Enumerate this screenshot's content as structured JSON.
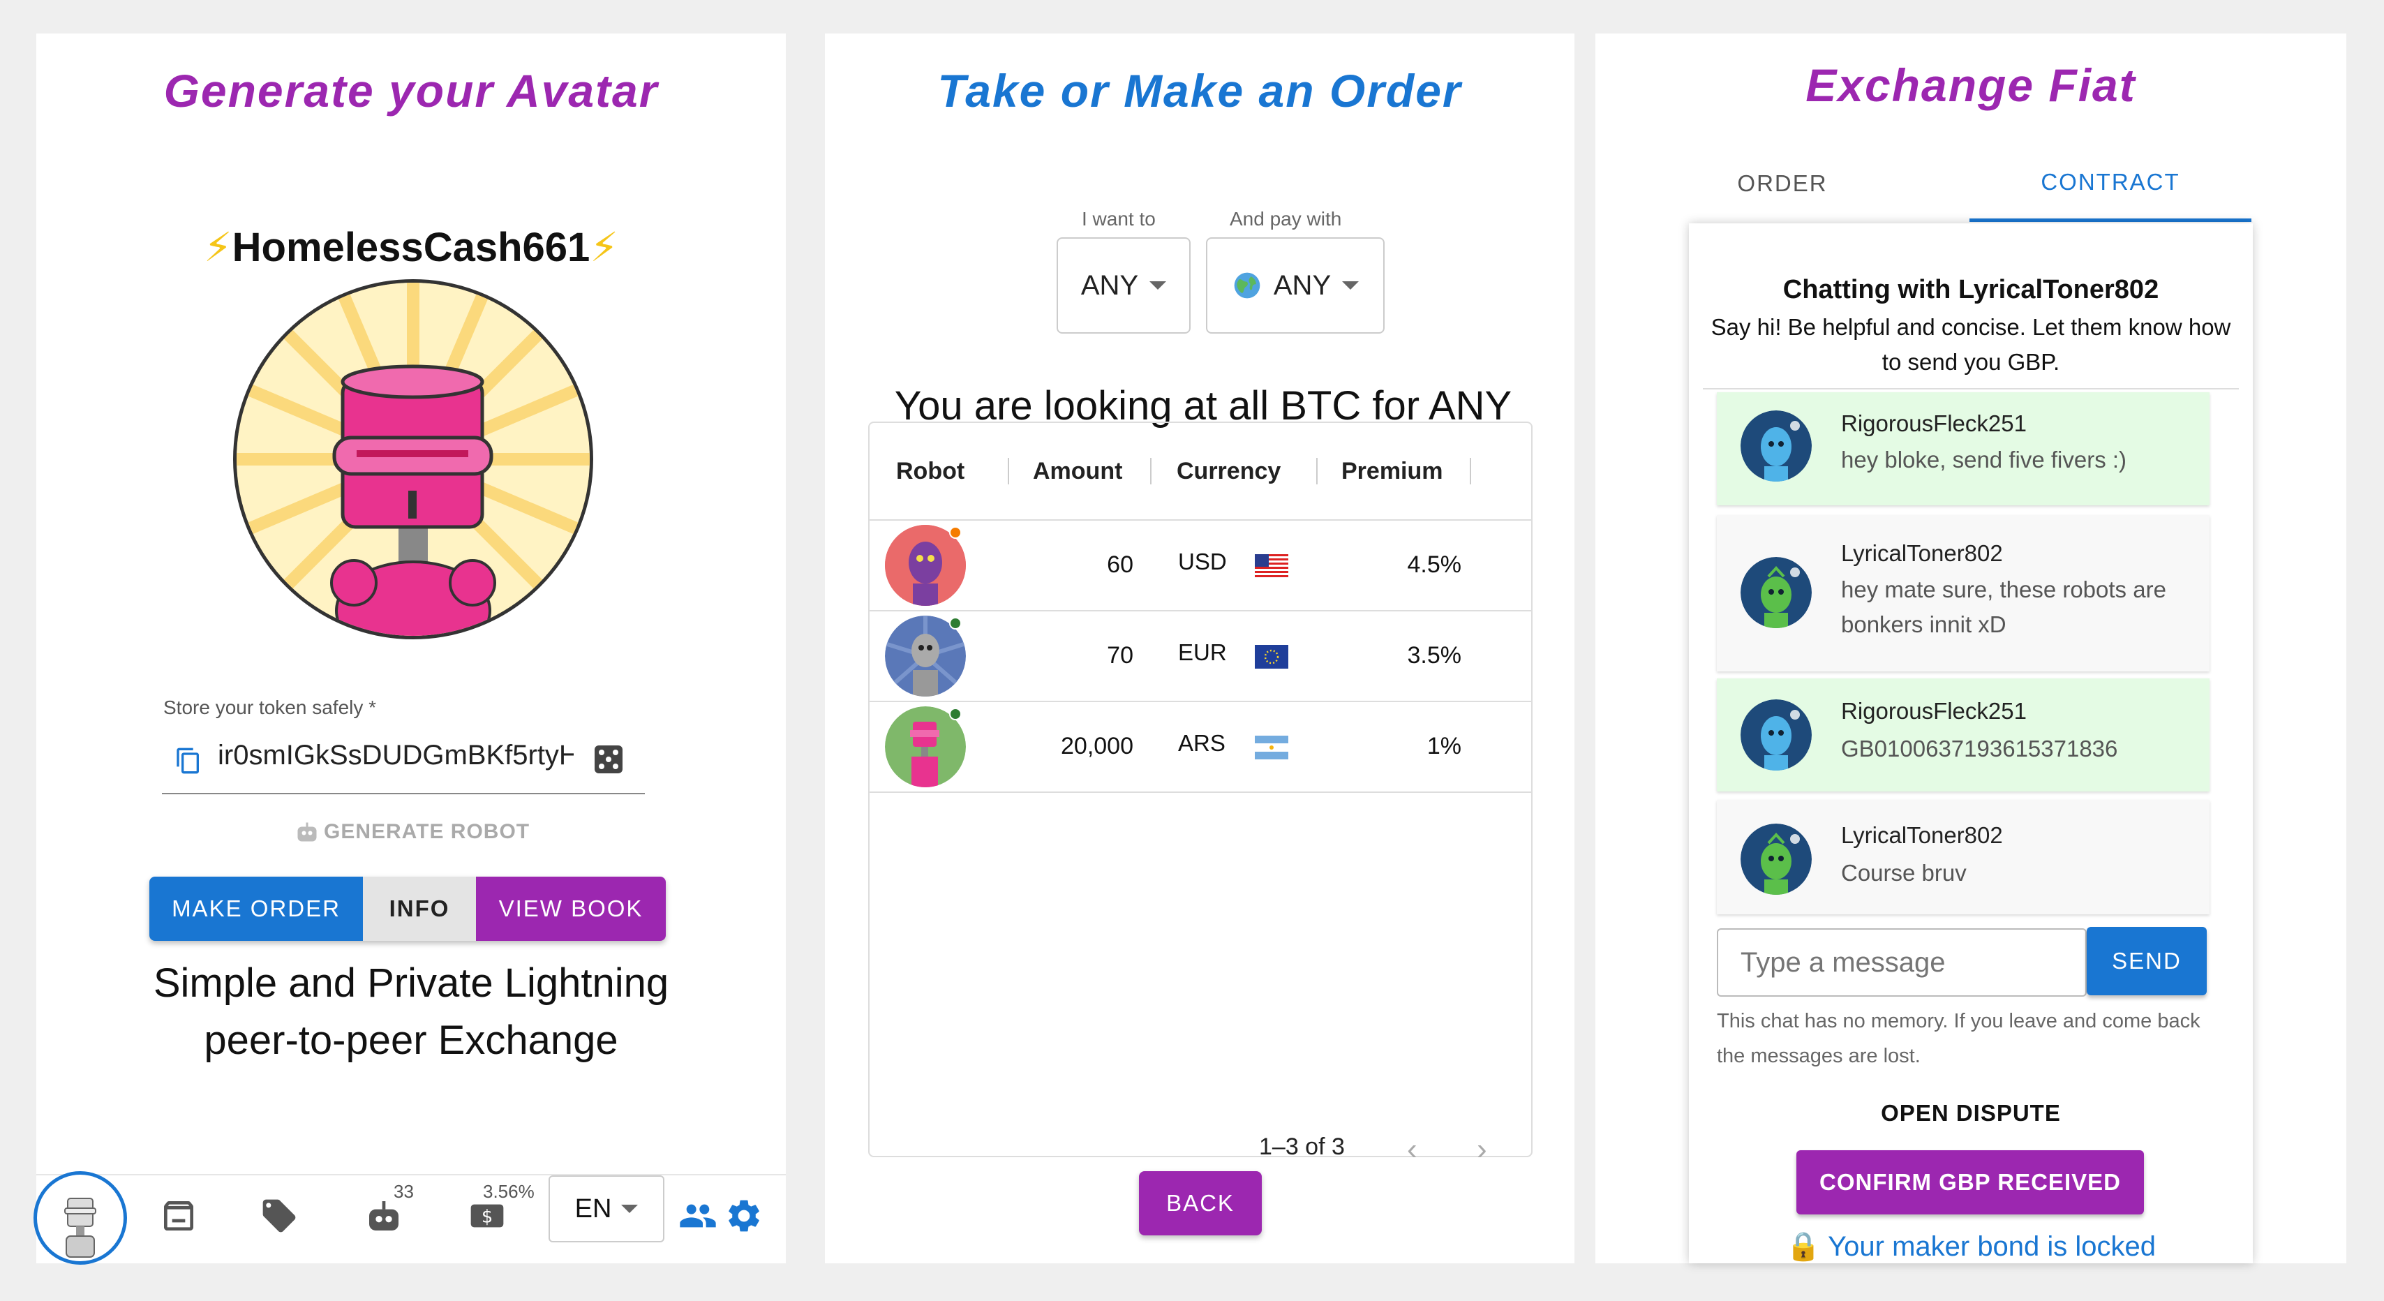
{
  "panel1": {
    "title": "Generate your Avatar",
    "nickname": "HomelessCash661",
    "bolt": "⚡",
    "token_label": "Store your token safely *",
    "token_value": "ir0smIGkSsDUDGmBKf5rtyH",
    "generate_label": "GENERATE ROBOT",
    "buttons": {
      "make_order": "MAKE ORDER",
      "info": "INFO",
      "view_book": "VIEW BOOK"
    },
    "tagline_1": "Simple and Private Lightning",
    "tagline_2": "peer-to-peer Exchange",
    "bottom_bar": {
      "robots_count": "33",
      "premium": "3.56%",
      "language": "EN"
    },
    "colors": {
      "purple": "#9c27b0",
      "blue": "#1976d2",
      "robot_pink": "#e8338f"
    }
  },
  "panel2": {
    "title": "Take or Make an Order",
    "want_label": "I want to",
    "want_value": "ANY",
    "pay_label": "And pay with",
    "pay_value": "ANY",
    "pay_icon": "globe-icon",
    "heading": "You are looking at all BTC for ANY",
    "columns": [
      "Robot",
      "Amount",
      "Currency",
      "Premium"
    ],
    "rows": [
      {
        "amount": "60",
        "currency": "USD",
        "flag": "us-flag",
        "premium": "4.5%",
        "status": "#f57c00"
      },
      {
        "amount": "70",
        "currency": "EUR",
        "flag": "eu-flag",
        "premium": "3.5%",
        "status": "#2e7d32"
      },
      {
        "amount": "20,000",
        "currency": "ARS",
        "flag": "ar-flag",
        "premium": "1%",
        "status": "#2e7d32"
      }
    ],
    "pagination": "1–3 of 3",
    "back": "BACK"
  },
  "panel3": {
    "title": "Exchange Fiat",
    "tabs": {
      "order": "ORDER",
      "contract": "CONTRACT"
    },
    "chat_title": "Chatting with LyricalToner802",
    "chat_sub": "Say hi! Be helpful and concise. Let them know how to send you GBP.",
    "messages": [
      {
        "name": "RigorousFleck251",
        "text": "hey bloke, send five fivers :)"
      },
      {
        "name": "LyricalToner802",
        "text": "hey mate sure, these robots are bonkers innit xD"
      },
      {
        "name": "RigorousFleck251",
        "text": "GB0100637193615371836"
      },
      {
        "name": "LyricalToner802",
        "text": "Course bruv"
      }
    ],
    "input_placeholder": "Type a message",
    "send": "SEND",
    "memory_note": "This chat has no memory. If you leave and come back the messages are lost.",
    "dispute": "OPEN DISPUTE",
    "confirm": "CONFIRM GBP RECEIVED",
    "bond": "🔒 Your maker bond is locked"
  }
}
